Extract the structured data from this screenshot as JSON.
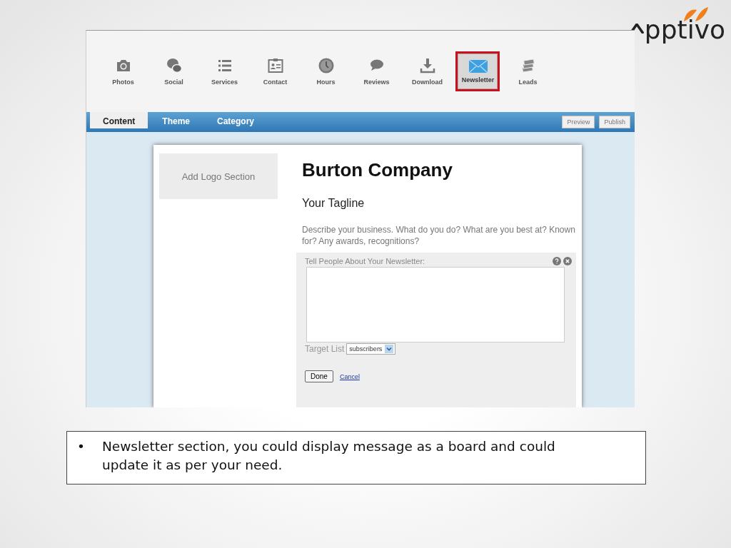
{
  "logo": {
    "text": "pptivo"
  },
  "toolbar": [
    {
      "label": "Photos",
      "kind": "camera",
      "selected": false
    },
    {
      "label": "Social",
      "kind": "chat-bubbles",
      "selected": false
    },
    {
      "label": "Services",
      "kind": "list",
      "selected": false
    },
    {
      "label": "Contact",
      "kind": "id-card",
      "selected": false
    },
    {
      "label": "Hours",
      "kind": "clock",
      "selected": false
    },
    {
      "label": "Reviews",
      "kind": "speech",
      "selected": false
    },
    {
      "label": "Download",
      "kind": "download",
      "selected": false
    },
    {
      "label": "Newsletter",
      "kind": "envelope",
      "selected": true
    },
    {
      "label": "Leads",
      "kind": "stack",
      "selected": false
    }
  ],
  "tabs": [
    {
      "label": "Content",
      "selected": true
    },
    {
      "label": "Theme",
      "selected": false
    },
    {
      "label": "Category",
      "selected": false
    }
  ],
  "actions": [
    "Preview",
    "Publish"
  ],
  "page": {
    "logo_section": "Add Logo Section",
    "company": "Burton Company",
    "tagline": "Your Tagline",
    "description": "Describe your business. What do you do? What are you best at? Known for? Any awards, recognitions?",
    "newsletter": {
      "label": "Tell People About Your Newsletter:",
      "target_label": "Target List",
      "target_value": "subscribers",
      "done": "Done",
      "cancel": "Cancel"
    }
  },
  "caption": {
    "bullet": "•",
    "text": "Newsletter section, you could display message as a board and could update it as per your need."
  }
}
